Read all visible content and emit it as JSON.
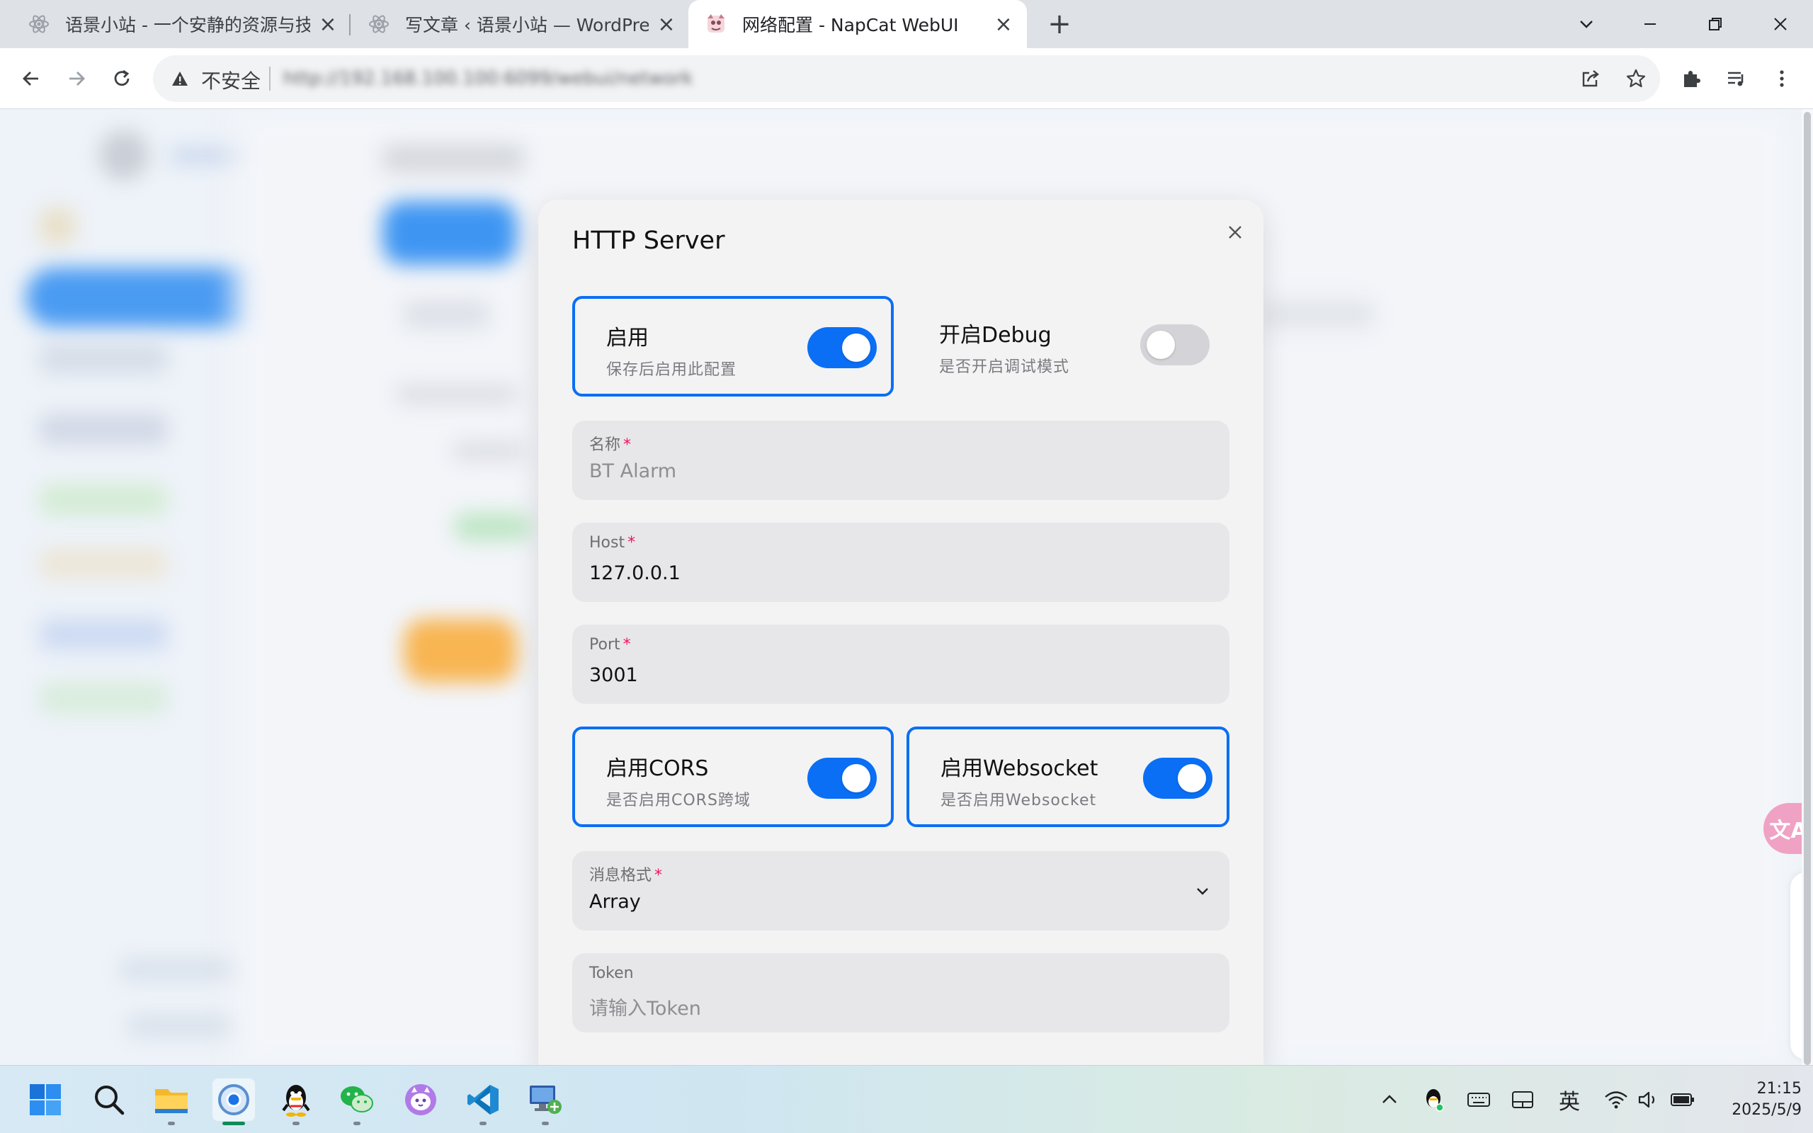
{
  "browser": {
    "tabs": [
      {
        "title": "语景小站 - 一个安静的资源与技",
        "favicon": "react-atom-icon"
      },
      {
        "title": "写文章 ‹ 语景小站 — WordPres",
        "favicon": "react-atom-icon"
      },
      {
        "title": "网络配置 - NapCat WebUI",
        "favicon": "napcat-icon",
        "active": true
      }
    ],
    "address": {
      "security_label": "不安全",
      "url": "http://192.168.100.100:6099/webui/network"
    }
  },
  "modal": {
    "title": "HTTP Server",
    "enable": {
      "title": "启用",
      "subtitle": "保存后启用此配置",
      "on": true
    },
    "debug": {
      "title": "开启Debug",
      "subtitle": "是否开启调试模式",
      "on": false
    },
    "name": {
      "label": "名称",
      "placeholder": "BT Alarm"
    },
    "host": {
      "label": "Host",
      "value": "127.0.0.1"
    },
    "port": {
      "label": "Port",
      "value": "3001"
    },
    "cors": {
      "title": "启用CORS",
      "subtitle": "是否启用CORS跨域",
      "on": true
    },
    "websocket": {
      "title": "启用Websocket",
      "subtitle": "是否启用Websocket",
      "on": true
    },
    "message_format": {
      "label": "消息格式",
      "value": "Array"
    },
    "token": {
      "label": "Token",
      "placeholder": "请输入Token"
    },
    "required_mark": "*"
  },
  "translate_badge": "文A",
  "taskbar": {
    "apps": [
      "windows-start-icon",
      "search-icon",
      "file-explorer-icon",
      "chrome-icon",
      "qq-icon",
      "wechat-icon",
      "cat-app-icon",
      "vscode-icon",
      "remote-desktop-icon"
    ],
    "ime": "英",
    "time": "21:15",
    "date": "2025/5/9"
  },
  "colors": {
    "accent": "#0a6ff5",
    "required": "#f31260"
  }
}
